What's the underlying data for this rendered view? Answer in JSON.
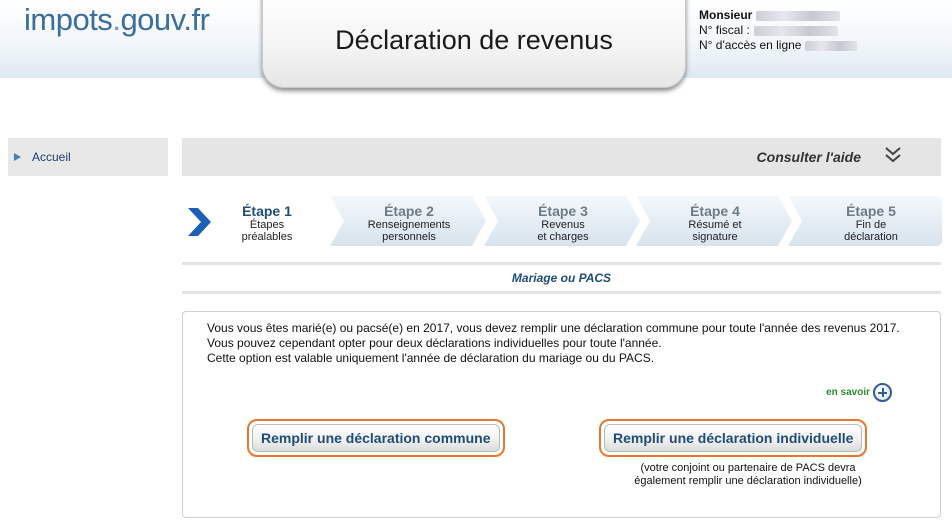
{
  "header": {
    "logo_text": "impots",
    "logo_dot": ".",
    "logo_suffix": "gouv.fr",
    "title": "Déclaration de revenus"
  },
  "user": {
    "salutation": "Monsieur",
    "fiscal_label": "N° fiscal :",
    "access_label": "N° d'accès en ligne"
  },
  "sidebar": {
    "items": [
      {
        "label": "Accueil"
      }
    ]
  },
  "help": {
    "label": "Consulter l'aide",
    "icon": "double-chevron-down-icon"
  },
  "steps": [
    {
      "title": "Étape 1",
      "subtitle_line1": "Étapes",
      "subtitle_line2": "préalables",
      "active": true
    },
    {
      "title": "Étape 2",
      "subtitle_line1": "Renseignements",
      "subtitle_line2": "personnels",
      "active": false
    },
    {
      "title": "Étape 3",
      "subtitle_line1": "Revenus",
      "subtitle_line2": "et charges",
      "active": false
    },
    {
      "title": "Étape 4",
      "subtitle_line1": "Résumé et",
      "subtitle_line2": "signature",
      "active": false
    },
    {
      "title": "Étape 5",
      "subtitle_line1": "Fin de",
      "subtitle_line2": "déclaration",
      "active": false
    }
  ],
  "section": {
    "title": "Mariage ou PACS"
  },
  "content": {
    "paragraph1": "Vous vous êtes marié(e) ou pacsé(e) en 2017, vous devez remplir une déclaration commune pour toute l'année des revenus 2017.",
    "paragraph2": "Vous pouvez cependant opter pour deux déclarations individuelles pour toute l'année.",
    "paragraph3": "Cette option est valable uniquement l'année de déclaration du mariage ou du PACS.",
    "learn_more": "en savoir",
    "button_common": "Remplir une déclaration commune",
    "button_individual": "Remplir une déclaration individuelle",
    "individual_note_line1": "(votre conjoint ou partenaire de PACS devra",
    "individual_note_line2": "également remplir une déclaration individuelle)"
  },
  "colors": {
    "brand_blue": "#1f4d78",
    "logo_blue": "#3a6e9c",
    "highlight_orange": "#e8772e",
    "learn_more_green": "#2e8b2e"
  }
}
